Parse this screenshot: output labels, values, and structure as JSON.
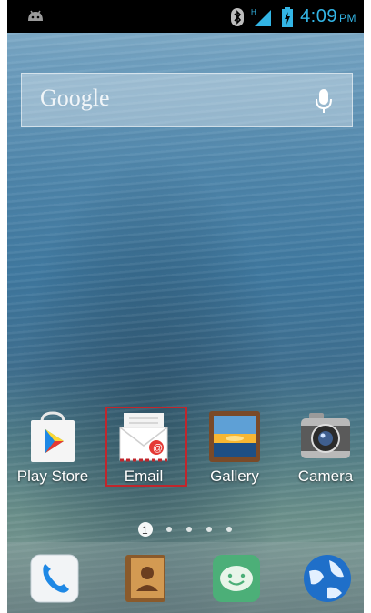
{
  "status_bar": {
    "time": "4:09",
    "ampm": "PM",
    "icons": [
      "android-icon",
      "bluetooth-icon",
      "signal-icon",
      "battery-charging-icon"
    ]
  },
  "search_widget": {
    "brand": "Google",
    "icon": "mic-icon"
  },
  "apps": [
    {
      "label": "Play Store",
      "icon": "play-store-icon"
    },
    {
      "label": "Email",
      "icon": "email-icon"
    },
    {
      "label": "Gallery",
      "icon": "gallery-icon"
    },
    {
      "label": "Camera",
      "icon": "camera-icon"
    }
  ],
  "pager": {
    "current_page": "1",
    "total_pages": 5
  },
  "dock": [
    {
      "icon": "phone-icon"
    },
    {
      "icon": "contacts-icon"
    },
    {
      "icon": "messaging-icon"
    },
    {
      "icon": "browser-icon"
    }
  ],
  "colors": {
    "time": "#33b5e5",
    "highlight": "#c0262c"
  }
}
